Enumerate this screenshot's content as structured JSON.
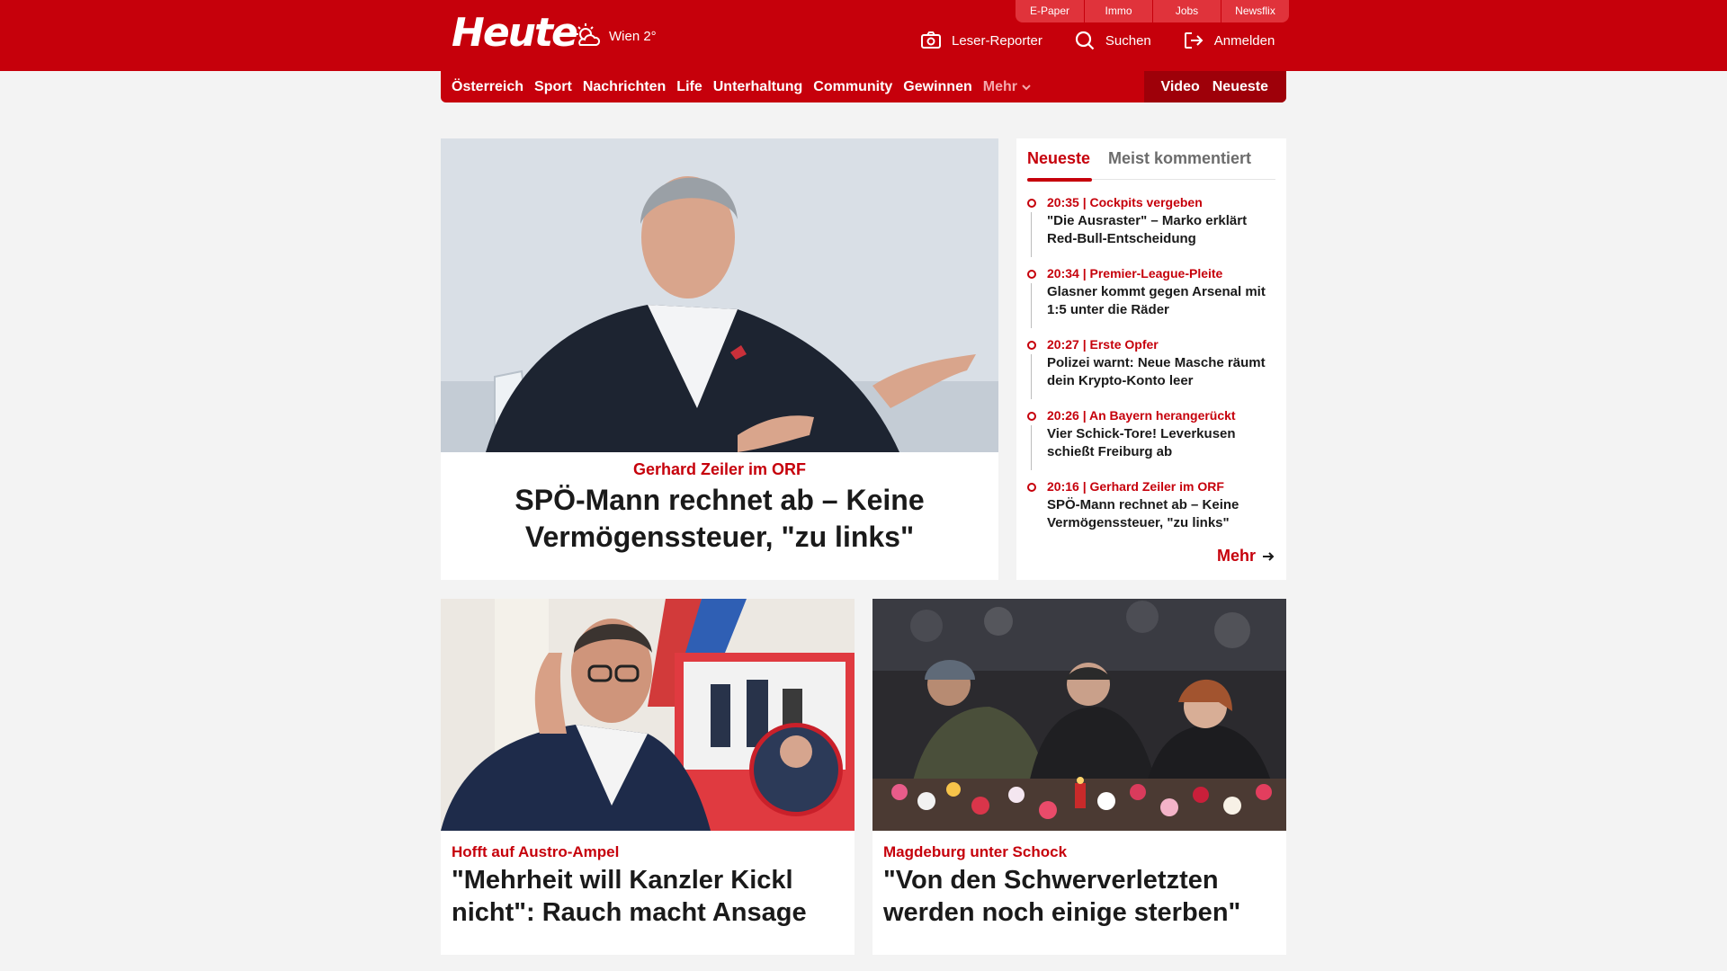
{
  "header": {
    "logo": "Heute",
    "weather": "Wien 2°",
    "mini_tabs": [
      "E-Paper",
      "Immo",
      "Jobs",
      "Newsflix"
    ],
    "actions": {
      "reporter": "Leser-Reporter",
      "search": "Suchen",
      "login": "Anmelden"
    }
  },
  "nav": {
    "items": [
      "Österreich",
      "Sport",
      "Nachrichten",
      "Life",
      "Unterhaltung",
      "Community",
      "Gewinnen"
    ],
    "more": "Mehr",
    "right": [
      "Video",
      "Neueste"
    ]
  },
  "lead": {
    "kicker": "Gerhard Zeiler im ORF",
    "title": "SPÖ-Mann rechnet ab – Keine Vermögenssteuer, \"zu links\""
  },
  "sidebar": {
    "tabs": [
      "Neueste",
      "Meist kommentiert"
    ],
    "items": [
      {
        "meta": "20:35 | Cockpits vergeben",
        "title": "\"Die Ausraster\" – Marko erklärt Red-Bull-Entscheidung"
      },
      {
        "meta": "20:34 | Premier-League-Pleite",
        "title": "Glasner kommt gegen Arsenal mit 1:5 unter die Räder"
      },
      {
        "meta": "20:27 | Erste Opfer",
        "title": "Polizei warnt: Neue Masche räumt dein Krypto-Konto leer"
      },
      {
        "meta": "20:26 | An Bayern herangerückt",
        "title": "Vier Schick-Tore! Leverkusen schießt Freiburg ab"
      },
      {
        "meta": "20:16 | Gerhard Zeiler im ORF",
        "title": "SPÖ-Mann rechnet ab – Keine Vermögenssteuer, \"zu links\""
      }
    ],
    "more": "Mehr"
  },
  "cards": [
    {
      "kicker": "Hofft auf Austro-Ampel",
      "title": "\"Mehrheit will Kanzler Kickl nicht\": Rauch macht Ansage"
    },
    {
      "kicker": "Magdeburg unter Schock",
      "title": "\"Von den Schwerverletzten werden noch einige sterben\""
    }
  ],
  "colors": {
    "brand": "#c6000b",
    "background": "#f3f3f3"
  }
}
